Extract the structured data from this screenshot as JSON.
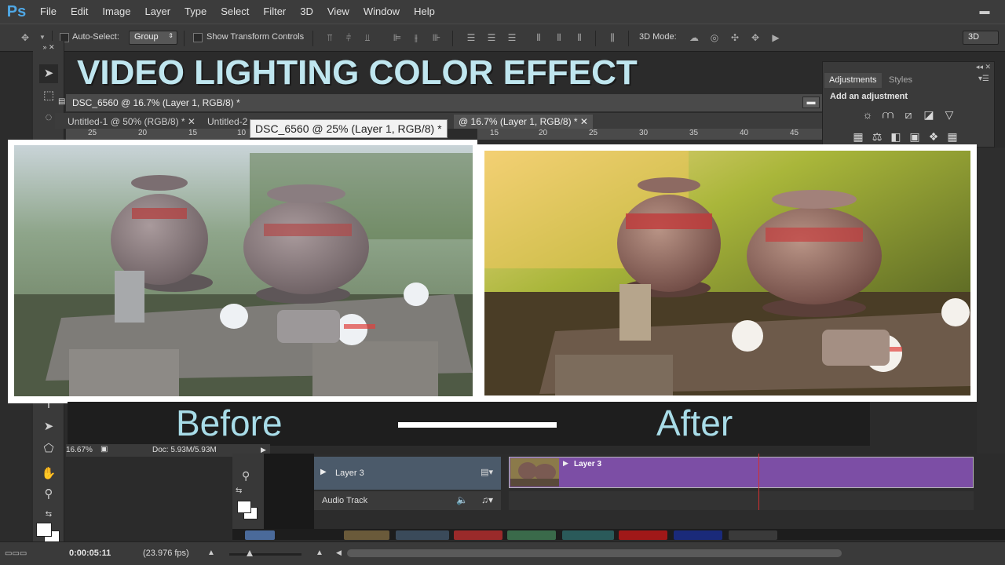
{
  "app": {
    "logo": "Ps"
  },
  "menu": [
    "File",
    "Edit",
    "Image",
    "Layer",
    "Type",
    "Select",
    "Filter",
    "3D",
    "View",
    "Window",
    "Help"
  ],
  "options": {
    "auto_select_label": "Auto-Select:",
    "group_value": "Group",
    "show_transform_label": "Show Transform Controls",
    "mode_3d_label": "3D Mode:",
    "workspace_value": "3D"
  },
  "banner_text": "VIDEO LIGHTING COLOR EFFECT",
  "document": {
    "title": "DSC_6560 @ 16.7% (Layer 1, RGB/8) *",
    "tabs": [
      "Untitled-1 @ 50% (RGB/8) *",
      "Untitled-2",
      "@ 16.7% (Layer 1, RGB/8) *"
    ],
    "tooltip": "DSC_6560 @ 25% (Layer 1, RGB/8) *",
    "ruler_left": [
      "25",
      "20",
      "15",
      "10"
    ],
    "ruler_right": [
      "15",
      "20",
      "25",
      "30",
      "35",
      "40",
      "45"
    ]
  },
  "adjustments": {
    "tab_adjustments": "Adjustments",
    "tab_styles": "Styles",
    "add_label": "Add an adjustment"
  },
  "captions": {
    "before": "Before",
    "after": "After"
  },
  "status": {
    "zoom": "16.67%",
    "doc": "Doc: 5.93M/5.93M"
  },
  "timeline": {
    "layer_name": "Layer 3",
    "audio_track": "Audio Track",
    "clip_label": "Layer 3",
    "timecode": "0:00:05:11",
    "fps": "(23.976 fps)"
  },
  "colors": {
    "accent_text": "#a8dce8",
    "clip_purple": "#7c4ea5",
    "playhead": "#d23030"
  }
}
